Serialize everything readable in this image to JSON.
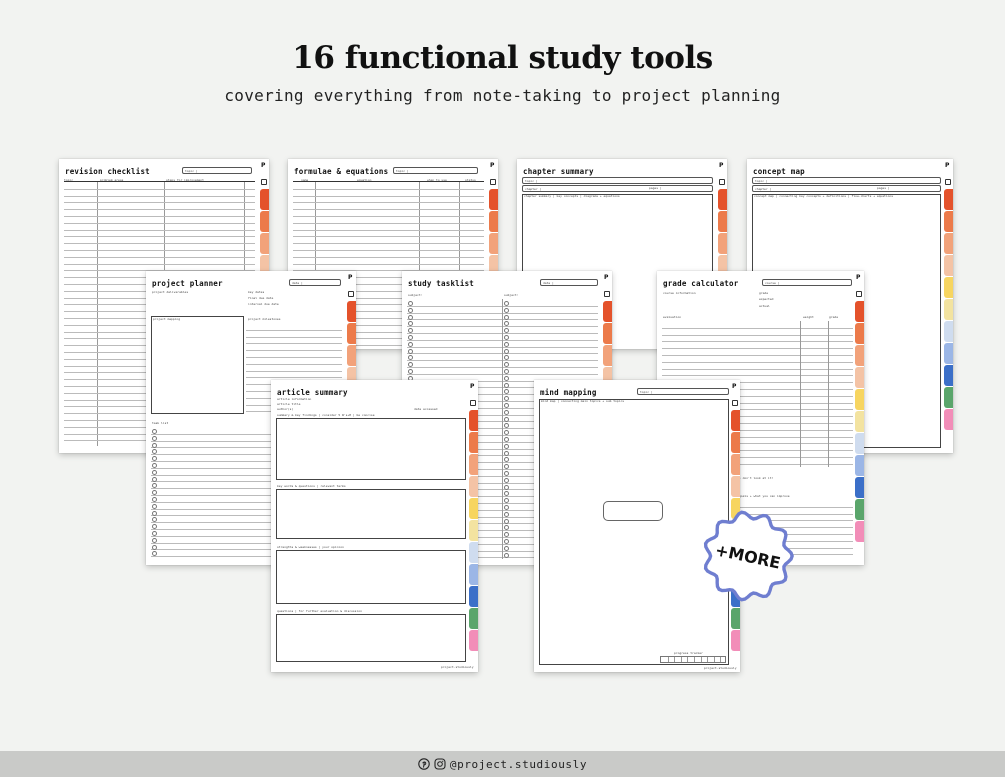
{
  "header": {
    "title": "16 functional study tools",
    "subtitle": "covering everything from note-taking to project planning"
  },
  "badge": {
    "label": "+MORE"
  },
  "footer": {
    "handle": "@project.studiously",
    "icons": [
      "pinterest-icon",
      "instagram-icon"
    ]
  },
  "tab_colors": [
    "#e4522b",
    "#ec7a4a",
    "#f2a27a",
    "#f4c3a5",
    "#f7d560",
    "#f3e3a0",
    "#cfdcef",
    "#9bb6e6",
    "#3b6fc8",
    "#5aa56b",
    "#f28db8",
    "#e84f94",
    "#c2409a",
    "#8d5ac4",
    "#b98ee0"
  ],
  "pages": {
    "revision_checklist": {
      "title": "revision checklist",
      "field": "topic |",
      "cols": [
        "topic",
        "problem areas",
        "steps for improvement"
      ]
    },
    "formulae": {
      "title": "formulae & equations",
      "field": "topic |",
      "cols": [
        "name",
        "equation",
        "when to use",
        "status"
      ]
    },
    "chapter_summary": {
      "title": "chapter summary",
      "field1": "topic |",
      "field2": "chapter |",
      "field3": "pages |",
      "note": "chapter summary | key concepts | diagrams + equations"
    },
    "concept_map": {
      "title": "concept map",
      "field1": "topic |",
      "field2": "chapter |",
      "field3": "pages |",
      "note": "concept map | connecting key concepts + definitions | flow-charts + equations"
    },
    "project_planner": {
      "title": "project planner",
      "field": "date |",
      "sec1": "project deliverables",
      "sec2": "key dates",
      "sec2a": "final due date",
      "sec2b": "internal due date",
      "sec3": "project mapping",
      "sec4": "project milestones",
      "sec5": "task list"
    },
    "study_tasklist": {
      "title": "study tasklist",
      "field": "date |",
      "subject": "subject:"
    },
    "grade_calculator": {
      "title": "grade calculator",
      "field": "course |",
      "sec1": "course information",
      "sec2": "grade",
      "sec2a": "expected",
      "sec2b": "actual",
      "sec3": "evaluation",
      "col1": "weight",
      "col2": "grade",
      "note1": "i don't look at it!",
      "note2": "goals + what you can improve",
      "tracker": "progress tracker"
    },
    "article_summary": {
      "title": "article summary",
      "sec1": "article information",
      "sec1a": "article title",
      "sec1b": "author(s)",
      "sec1c": "date accessed",
      "sec2": "summary & key findings | consider 5 W's+H | be concise",
      "sec3": "key words & questions | relevant terms",
      "sec4": "strengths & weaknesses | your opinion",
      "sec5": "questions | for further evaluation & discussion",
      "foot": "project.studiously"
    },
    "mind_mapping": {
      "title": "mind mapping",
      "field": "topic |",
      "note": "mind map | connecting main topics + sub topics",
      "tracker": "progress tracker",
      "foot": "project.studiously"
    }
  }
}
